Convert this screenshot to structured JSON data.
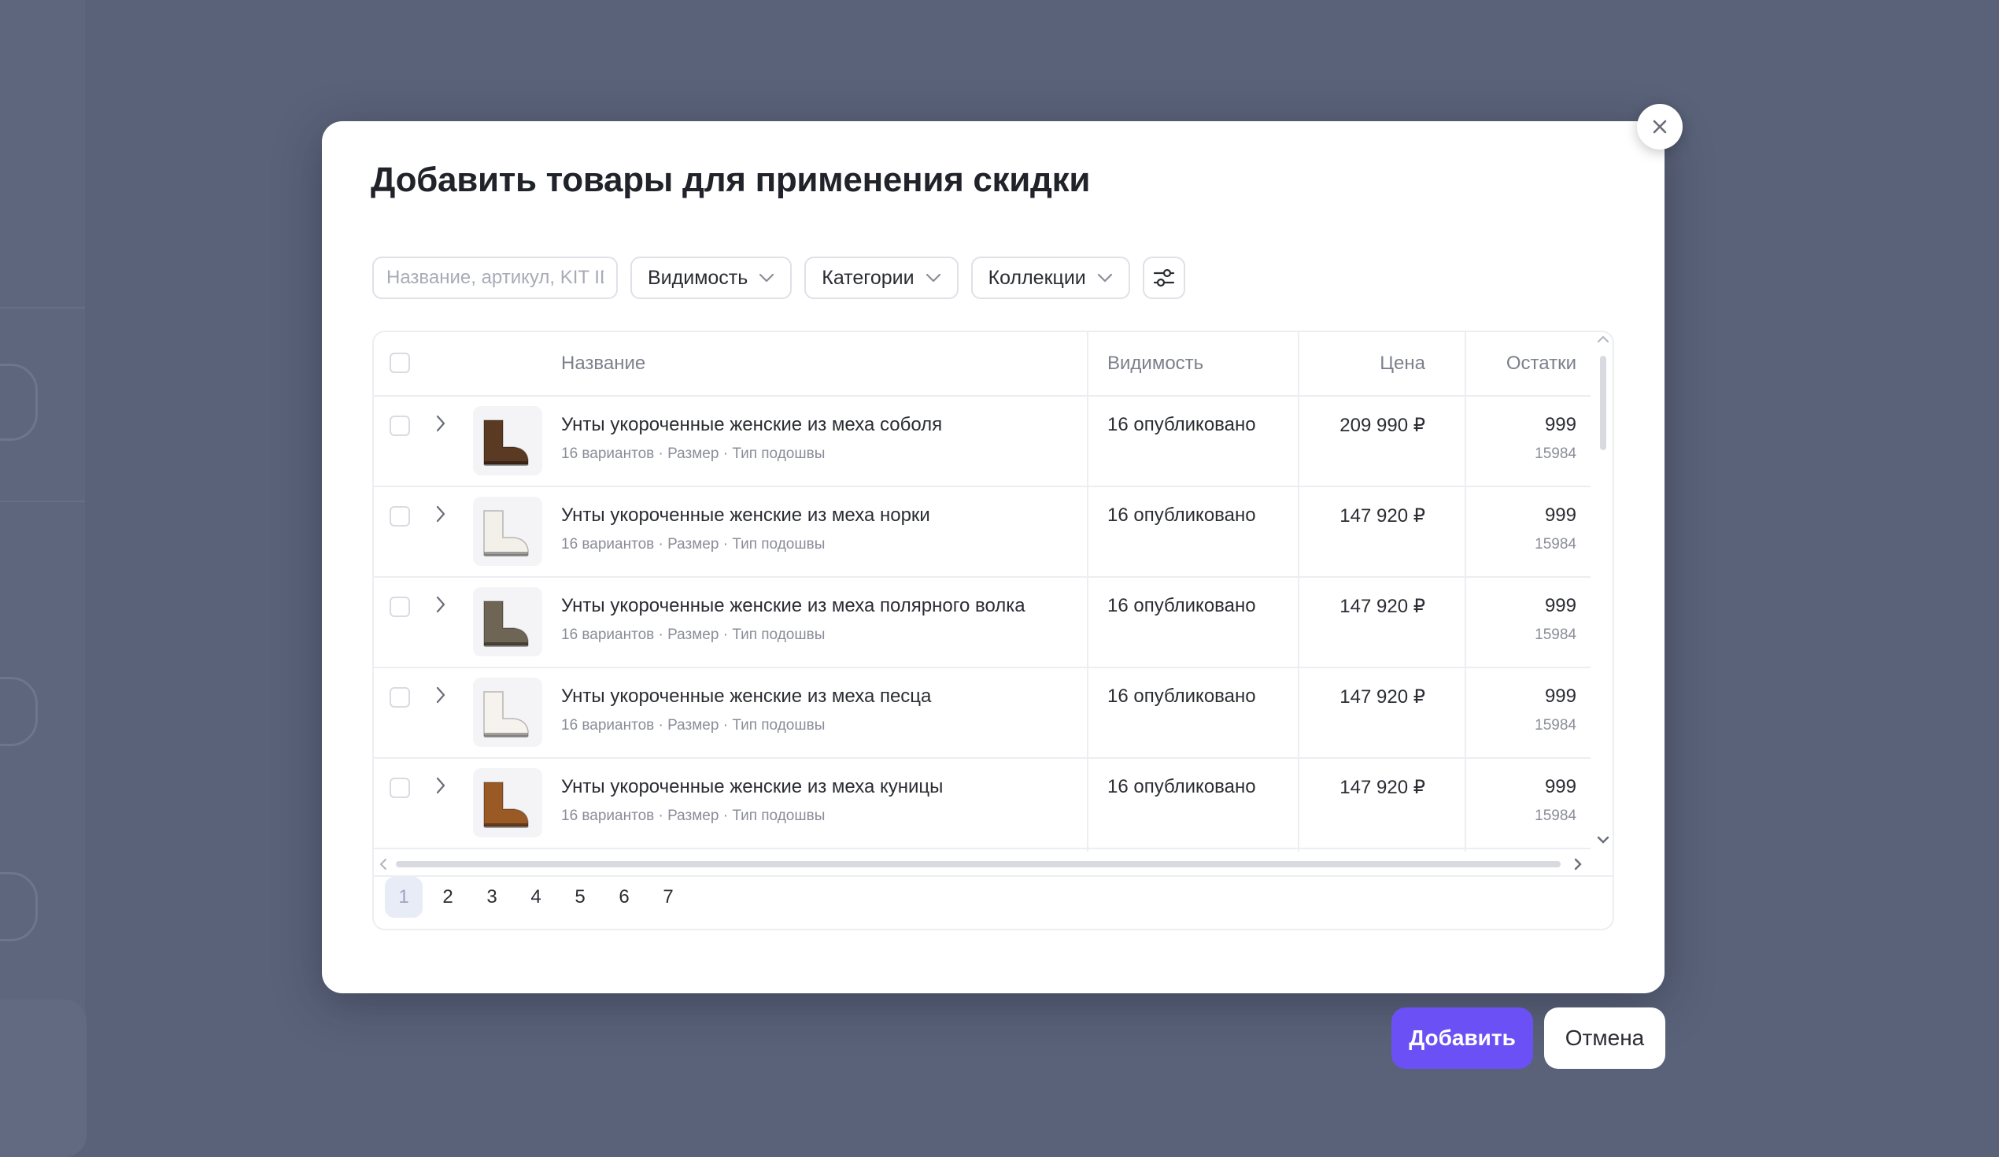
{
  "modal": {
    "title": "Добавить товары для применения скидки",
    "close_icon": "close-icon"
  },
  "filters": {
    "search_placeholder": "Название, артикул, KIT ID",
    "visibility_label": "Видимость",
    "categories_label": "Категории",
    "collections_label": "Коллекции",
    "settings_icon": "sliders-icon"
  },
  "table": {
    "columns": {
      "name": "Название",
      "visibility": "Видимость",
      "price": "Цена",
      "stock": "Остатки"
    },
    "rows": [
      {
        "name": "Унты укороченные женские из меха соболя",
        "meta": "16 вариантов · Размер · Тип подошвы",
        "visibility": "16 опубликовано",
        "price": "209 990 ₽",
        "stock": "999",
        "stock_sub": "15984",
        "thumb_color": "#5a3a22"
      },
      {
        "name": "Унты укороченные женские из меха норки",
        "meta": "16 вариантов · Размер · Тип подошвы",
        "visibility": "16 опубликовано",
        "price": "147 920 ₽",
        "stock": "999",
        "stock_sub": "15984",
        "thumb_color": "#f3f0ea"
      },
      {
        "name": "Унты укороченные женские из меха полярного волка",
        "meta": "16 вариантов · Размер · Тип подошвы",
        "visibility": "16 опубликовано",
        "price": "147 920 ₽",
        "stock": "999",
        "stock_sub": "15984",
        "thumb_color": "#6e6554"
      },
      {
        "name": "Унты укороченные женские из меха песца",
        "meta": "16 вариантов · Размер · Тип подошвы",
        "visibility": "16 опубликовано",
        "price": "147 920 ₽",
        "stock": "999",
        "stock_sub": "15984",
        "thumb_color": "#f6f3ee"
      },
      {
        "name": "Унты укороченные женские из меха куницы",
        "meta": "16 вариантов · Размер · Тип подошвы",
        "visibility": "16 опубликовано",
        "price": "147 920 ₽",
        "stock": "999",
        "stock_sub": "15984",
        "thumb_color": "#9a5a26"
      }
    ]
  },
  "pagination": {
    "pages": [
      "1",
      "2",
      "3",
      "4",
      "5",
      "6",
      "7"
    ],
    "current": "1"
  },
  "actions": {
    "add_label": "Добавить",
    "cancel_label": "Отмена"
  },
  "colors": {
    "accent": "#6b51f5",
    "backdrop": "#5a6279"
  }
}
